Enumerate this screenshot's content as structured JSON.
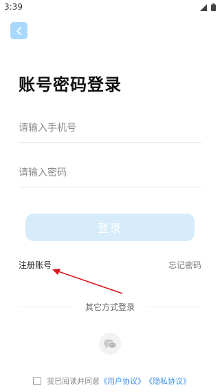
{
  "status_bar": {
    "time": "3:39"
  },
  "login": {
    "title": "账号密码登录",
    "phone_placeholder": "请输入手机号",
    "password_placeholder": "请输入密码",
    "login_button": "登录",
    "register_link": "注册账号",
    "forgot_link": "忘记密码"
  },
  "other_login": {
    "label": "其它方式登录"
  },
  "agreement": {
    "prefix": "我已阅读并同意",
    "user_agreement": "《用户协议》",
    "privacy_agreement": "《隐私协议》"
  },
  "colors": {
    "accent": "#a9d8ff",
    "button_bg": "#d6ecfb",
    "link": "#3a8ee6",
    "annotation": "#d9141e"
  },
  "icons": {
    "back": "chevron-left-icon",
    "wechat": "wechat-icon",
    "signal": "signal-icon",
    "battery": "battery-icon"
  }
}
